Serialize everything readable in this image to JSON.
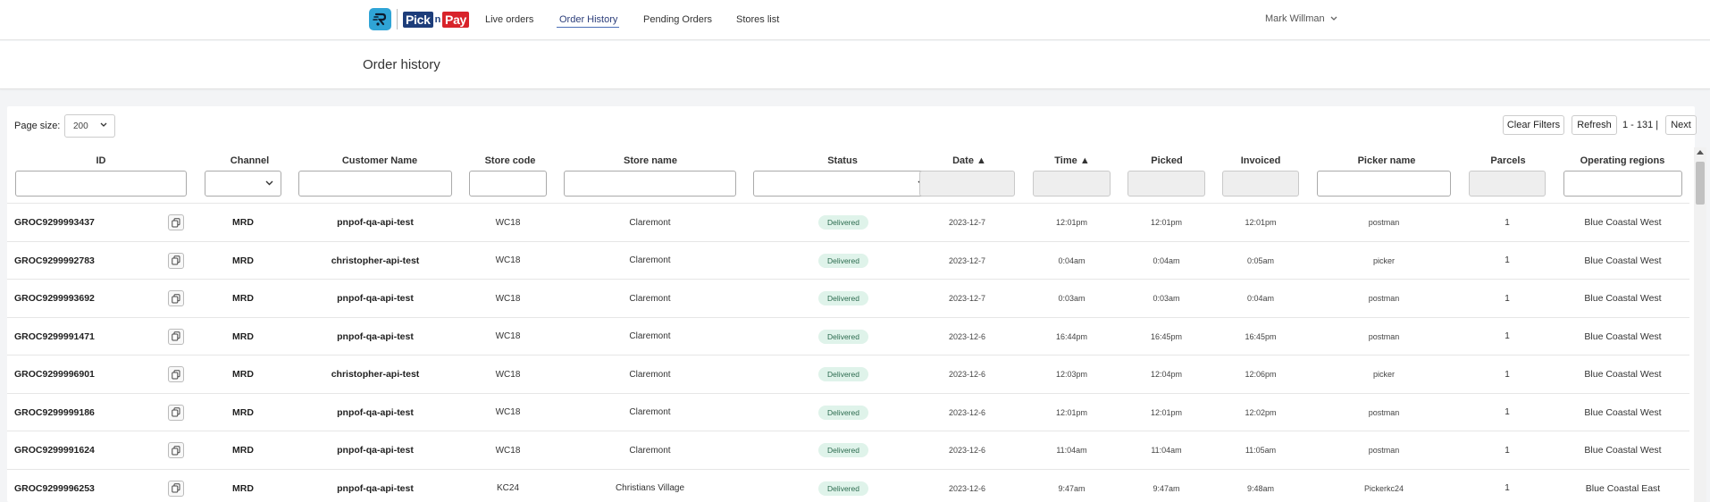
{
  "nav": {
    "brand": {
      "pick": "Pick",
      "n": "n",
      "pay": "Pay"
    },
    "links": [
      "Live orders",
      "Order History",
      "Pending Orders",
      "Stores list"
    ],
    "active_link": "Order History",
    "user_name": "Mark Willman"
  },
  "page": {
    "title": "Order history"
  },
  "toolbar": {
    "page_size_label": "Page size:",
    "page_size_value": "200",
    "clear_filters_label": "Clear Filters",
    "refresh_label": "Refresh",
    "pagination_text": "1 - 131 |",
    "next_label": "Next"
  },
  "table": {
    "columns": [
      "ID",
      "Channel",
      "Customer Name",
      "Store code",
      "Store name",
      "Status",
      "Date ▲",
      "Time ▲",
      "Picked",
      "Invoiced",
      "Picker name",
      "Parcels",
      "Operating regions"
    ],
    "rows": [
      [
        "GROC9299993437",
        "MRD",
        "pnpof-qa-api-test",
        "WC18",
        "Claremont",
        "Delivered",
        "2023-12-7",
        "12:01pm",
        "12:01pm",
        "12:01pm",
        "postman",
        "1",
        "Blue Coastal West"
      ],
      [
        "GROC9299992783",
        "MRD",
        "christopher-api-test",
        "WC18",
        "Claremont",
        "Delivered",
        "2023-12-7",
        "0:04am",
        "0:04am",
        "0:05am",
        "picker",
        "1",
        "Blue Coastal West"
      ],
      [
        "GROC9299993692",
        "MRD",
        "pnpof-qa-api-test",
        "WC18",
        "Claremont",
        "Delivered",
        "2023-12-7",
        "0:03am",
        "0:03am",
        "0:04am",
        "postman",
        "1",
        "Blue Coastal West"
      ],
      [
        "GROC9299991471",
        "MRD",
        "pnpof-qa-api-test",
        "WC18",
        "Claremont",
        "Delivered",
        "2023-12-6",
        "16:44pm",
        "16:45pm",
        "16:45pm",
        "postman",
        "1",
        "Blue Coastal West"
      ],
      [
        "GROC9299996901",
        "MRD",
        "christopher-api-test",
        "WC18",
        "Claremont",
        "Delivered",
        "2023-12-6",
        "12:03pm",
        "12:04pm",
        "12:06pm",
        "picker",
        "1",
        "Blue Coastal West"
      ],
      [
        "GROC9299999186",
        "MRD",
        "pnpof-qa-api-test",
        "WC18",
        "Claremont",
        "Delivered",
        "2023-12-6",
        "12:01pm",
        "12:01pm",
        "12:02pm",
        "postman",
        "1",
        "Blue Coastal West"
      ],
      [
        "GROC9299991624",
        "MRD",
        "pnpof-qa-api-test",
        "WC18",
        "Claremont",
        "Delivered",
        "2023-12-6",
        "11:04am",
        "11:04am",
        "11:05am",
        "postman",
        "1",
        "Blue Coastal West"
      ],
      [
        "GROC9299996253",
        "MRD",
        "pnpof-qa-api-test",
        "KC24",
        "Christians Village",
        "Delivered",
        "2023-12-6",
        "9:47am",
        "9:47am",
        "9:48am",
        "Pickerkc24",
        "1",
        "Blue Coastal East"
      ]
    ]
  },
  "icons": {
    "app_logo": "scooter-icon",
    "user_menu": "chevron-down-icon",
    "copy": "copy-icon",
    "select": "chevron-down-icon"
  },
  "colors": {
    "brand_blue": "#1d3d7a",
    "brand_red": "#d8232a",
    "app_icon": "#2fa4d6",
    "status_delivered_bg": "#dff3ea",
    "status_delivered_text": "#2c6b4f"
  }
}
